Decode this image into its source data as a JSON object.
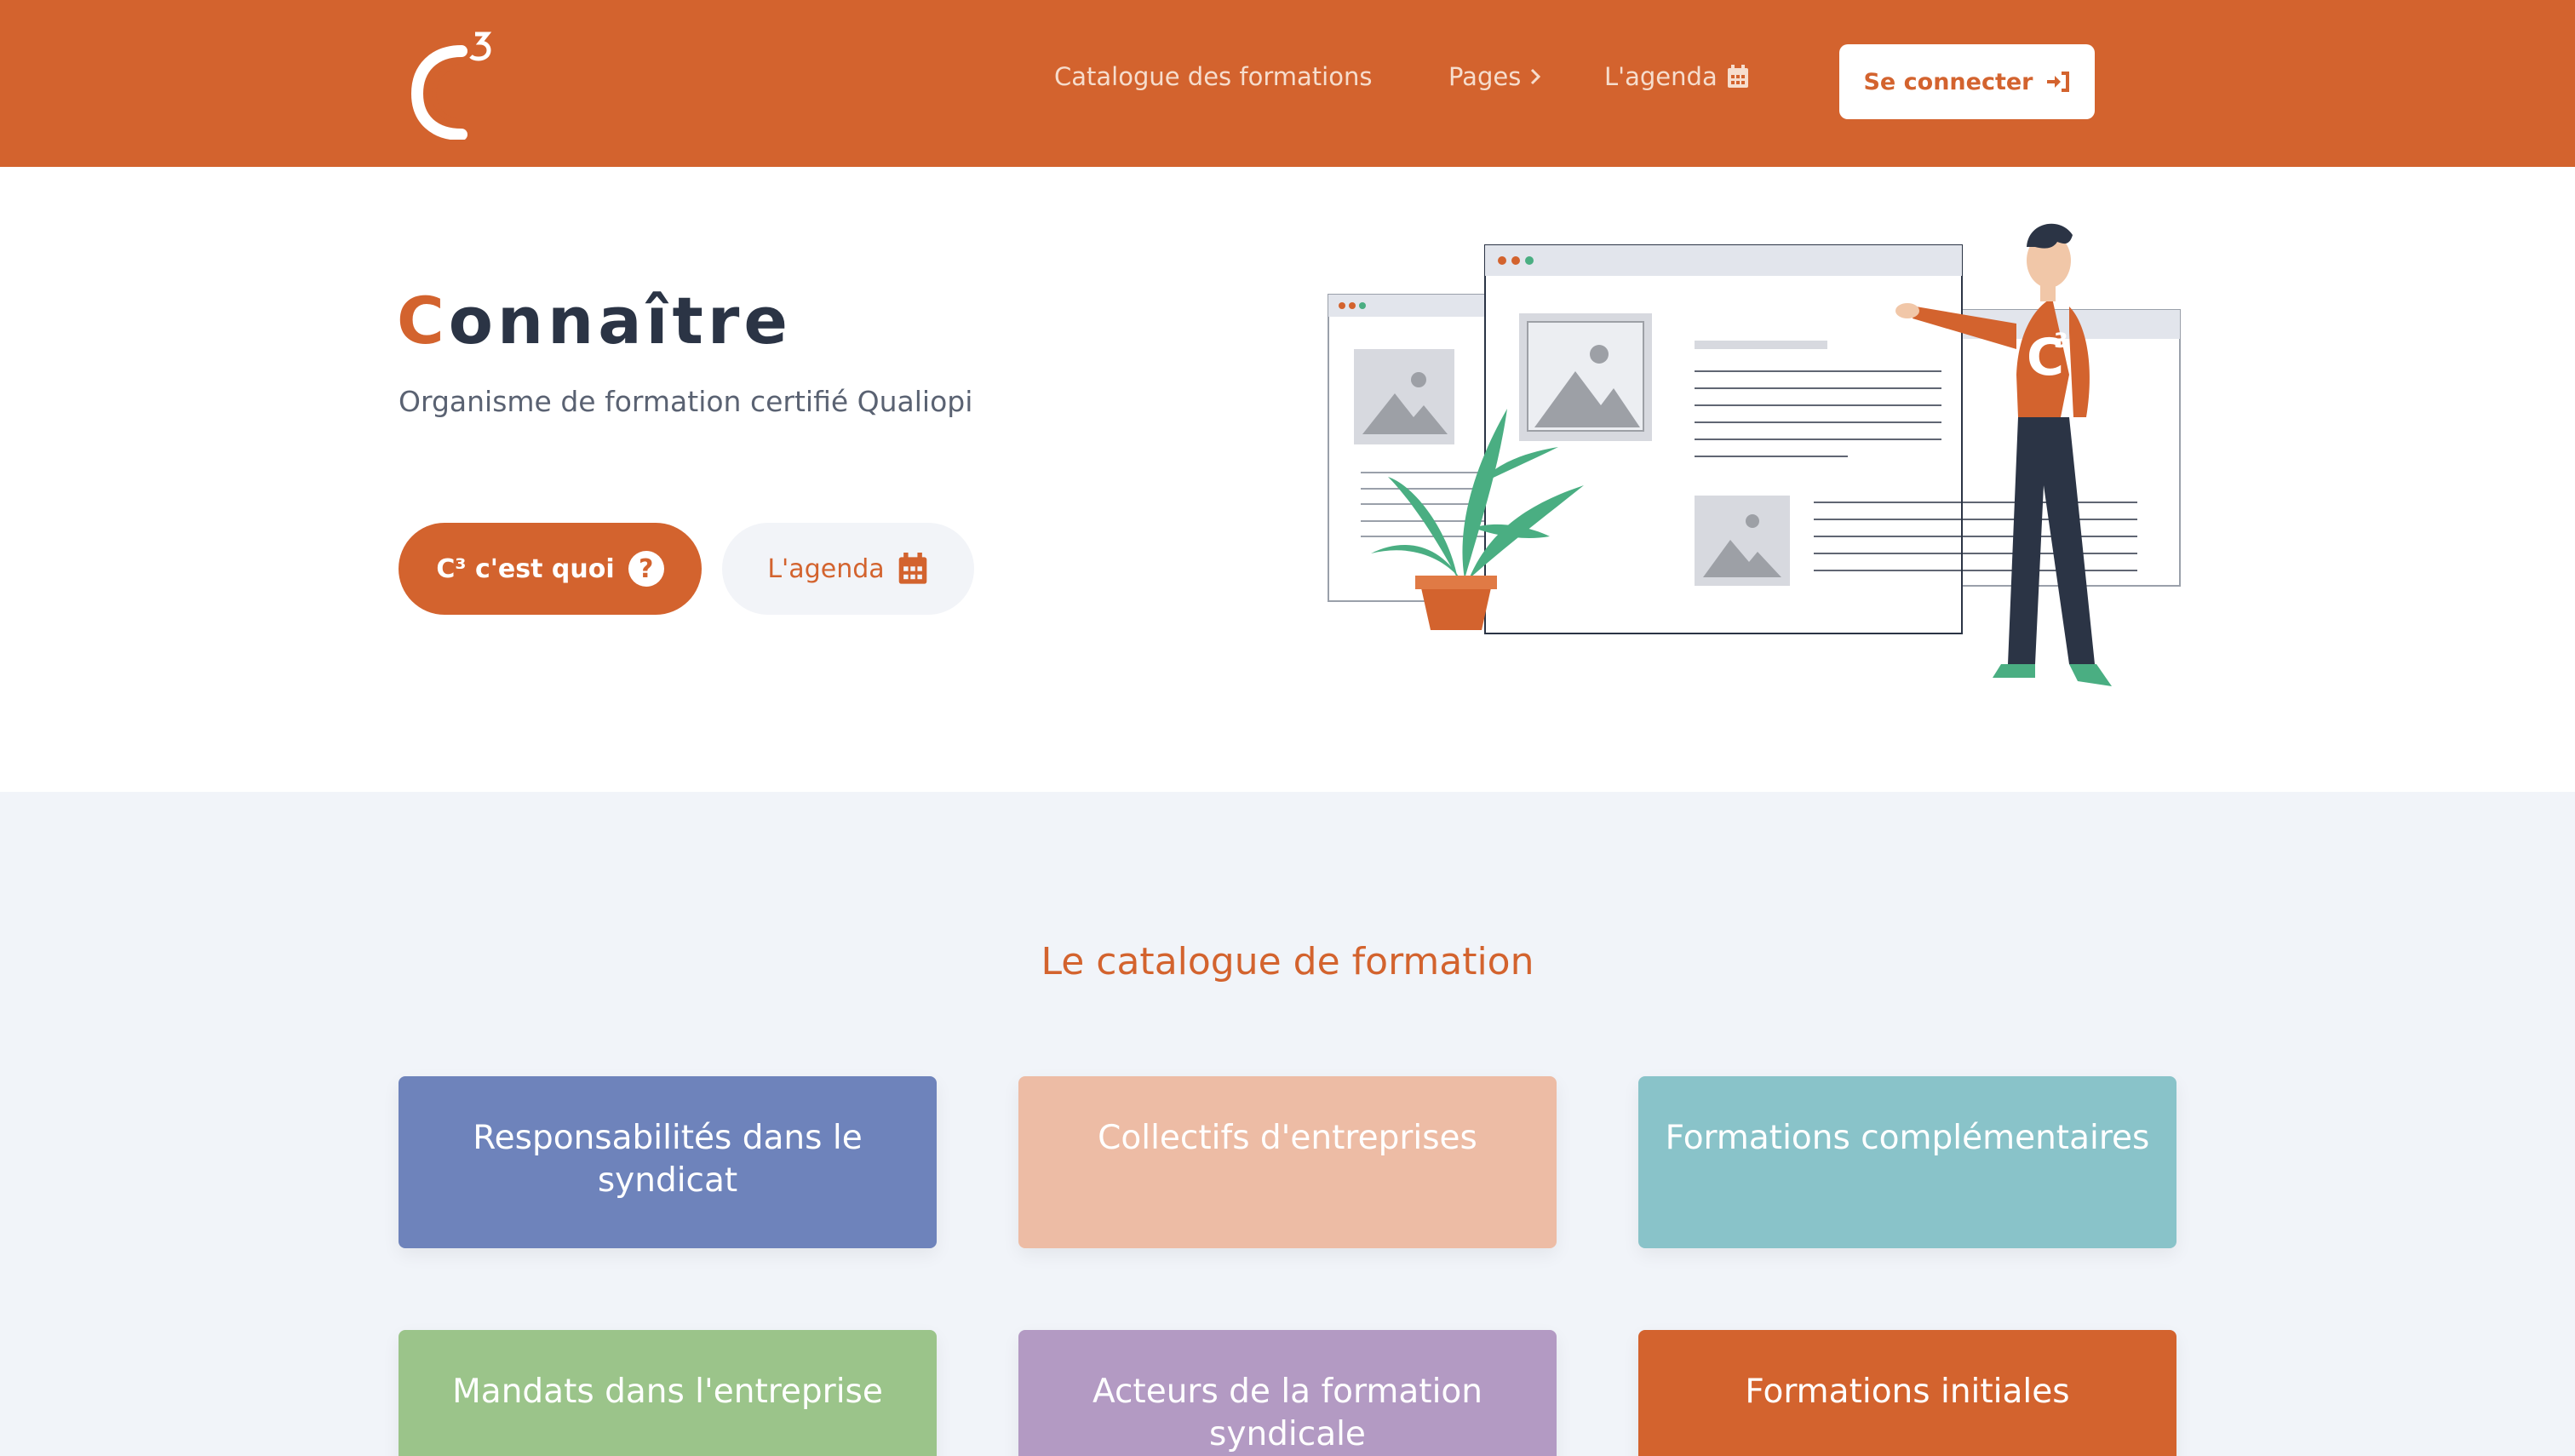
{
  "header": {
    "logo_alt": "C³",
    "nav": {
      "catalogue": "Catalogue des formations",
      "pages": "Pages",
      "agenda": "L'agenda"
    },
    "login_label": "Se connecter"
  },
  "hero": {
    "title_first_letter": "C",
    "title_rest": "onnaître",
    "subtitle": "Organisme de formation certifié Qualiopi",
    "primary_button": "C³ c'est quoi",
    "secondary_button": "L'agenda"
  },
  "catalogue": {
    "title": "Le catalogue de formation",
    "cards": [
      {
        "label": "Responsabilités dans le syndicat",
        "color": "#6e83bb"
      },
      {
        "label": "Collectifs d'entreprises",
        "color": "#edbca5"
      },
      {
        "label": "Formations complémentaires",
        "color": "#89c3c9"
      },
      {
        "label": "Mandats dans l'entreprise",
        "color": "#9bc48a"
      },
      {
        "label": "Acteurs de la formation syndicale",
        "color": "#b39ac3"
      },
      {
        "label": "Formations initiales",
        "color": "#d3632e"
      }
    ]
  },
  "colors": {
    "brand": "#d3632e",
    "text": "#2b3445",
    "section_bg": "#f1f4f9"
  },
  "icons": {
    "logo": "c3-logo",
    "pages_chevron": "chevron-right-icon",
    "agenda": "calendar-icon",
    "login": "sign-in-icon",
    "question": "question-circle-icon"
  }
}
